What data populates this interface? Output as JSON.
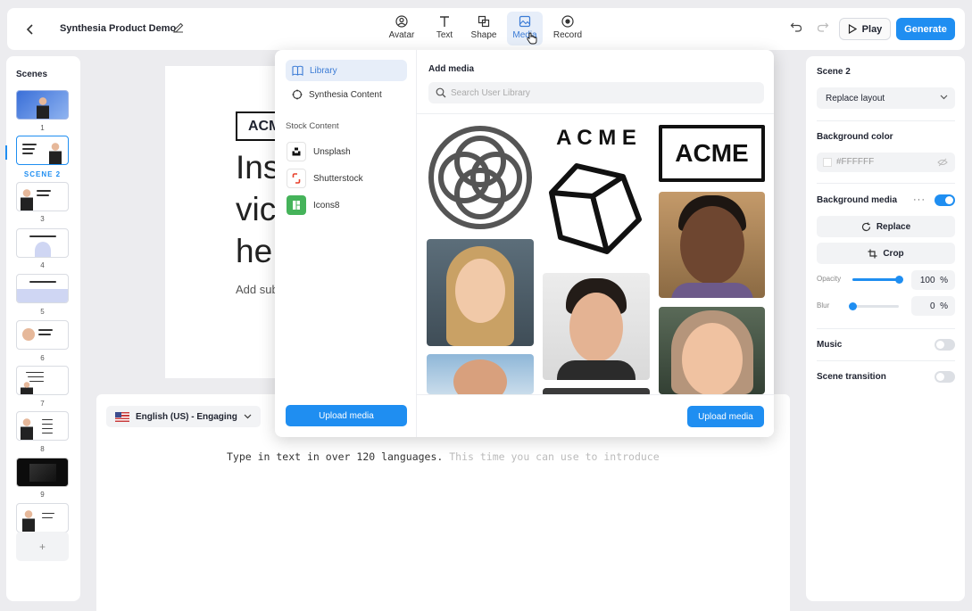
{
  "header": {
    "back_icon": "chevron-left-icon",
    "title": "Synthesia Product Demo",
    "edit_icon": "pencil-icon",
    "tools": [
      {
        "label": "Avatar",
        "icon": "avatar-icon"
      },
      {
        "label": "Text",
        "icon": "text-icon"
      },
      {
        "label": "Shape",
        "icon": "shape-icon"
      },
      {
        "label": "Media",
        "icon": "media-icon",
        "active": true
      },
      {
        "label": "Record",
        "icon": "record-icon"
      }
    ],
    "play_label": "Play",
    "generate_label": "Generate"
  },
  "scenes": {
    "title": "Scenes",
    "selected_label": "SCENE 2",
    "numbers": [
      "1",
      "3",
      "4",
      "5",
      "6",
      "7",
      "8",
      "9"
    ],
    "add_label": "+"
  },
  "canvas": {
    "logo_text": "ACME",
    "heading_lines": [
      "Ins",
      "vic",
      "he"
    ],
    "subtitle": "Add sub"
  },
  "script": {
    "language": "English (US) - Engaging",
    "text": "Type in text in over 120 languages.",
    "faded_text": " This time you can use to introduce"
  },
  "media_popup": {
    "nav": [
      {
        "label": "Library",
        "active": true
      },
      {
        "label": "Synthesia Content",
        "active": false
      }
    ],
    "stock_heading": "Stock Content",
    "sources": [
      {
        "label": "Unsplash",
        "color": "#ffffff"
      },
      {
        "label": "Shutterstock",
        "color": "#ffffff"
      },
      {
        "label": "Icons8",
        "color": "#45b35a"
      }
    ],
    "upload_label": "Upload media",
    "add_media_title": "Add media",
    "search_placeholder": "Search User Library",
    "acme_text": "ACME",
    "acme_wordmark": "A C M E"
  },
  "right_panel": {
    "scene_title": "Scene 2",
    "layout_select": "Replace layout",
    "bg_color_label": "Background color",
    "bg_color_value": "#FFFFFF",
    "bg_media_label": "Background media",
    "bg_media_enabled": true,
    "replace_label": "Replace",
    "crop_label": "Crop",
    "opacity_label": "Opacity",
    "opacity_value": "100",
    "opacity_level": 1.0,
    "blur_label": "Blur",
    "blur_value": "0",
    "blur_level": 0,
    "percent": "%",
    "music_label": "Music",
    "music_enabled": false,
    "transition_label": "Scene transition",
    "transition_enabled": false
  },
  "colors": {
    "accent": "#1f8ef1",
    "active_bg": "#e7eef9"
  }
}
